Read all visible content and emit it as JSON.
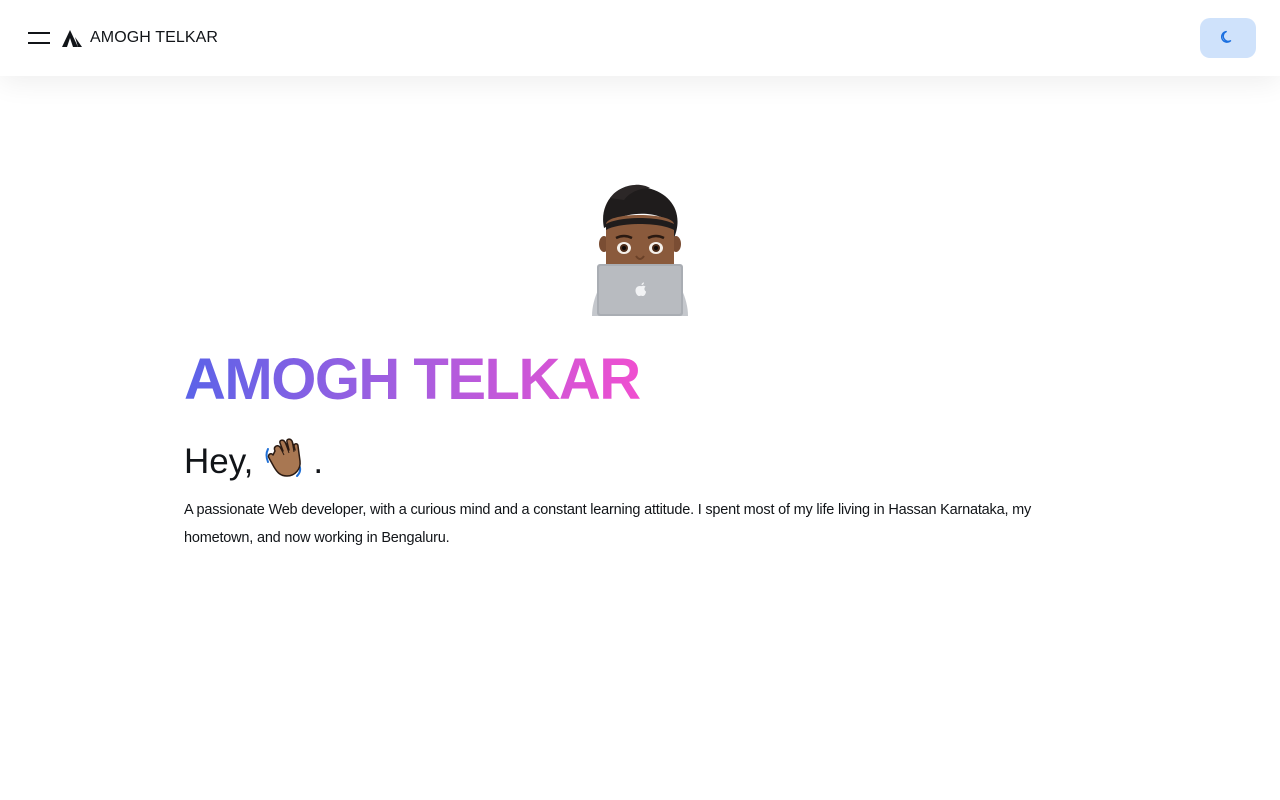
{
  "navbar": {
    "brand_name": "AMOGH TELKAR",
    "menu_icon": "hamburger-menu-icon",
    "logo_icon": "triangle-logo-icon",
    "theme_icon": "moon-icon",
    "theme_button_color": "#cfe2fb",
    "theme_icon_color": "#1a6fe0"
  },
  "hero": {
    "avatar": "memoji-laptop-avatar",
    "title": "AMOGH TELKAR",
    "title_gradient": [
      "#5b63e8",
      "#a45ee0",
      "#f04fd0"
    ],
    "greeting_text": "Hey,",
    "greeting_icon": "waving-hand-icon",
    "greeting_end": ".",
    "bio": "A passionate Web developer, with a curious mind and a constant learning attitude. I spent most of my life living in Hassan Karnataka, my hometown, and now working in Bengaluru."
  }
}
